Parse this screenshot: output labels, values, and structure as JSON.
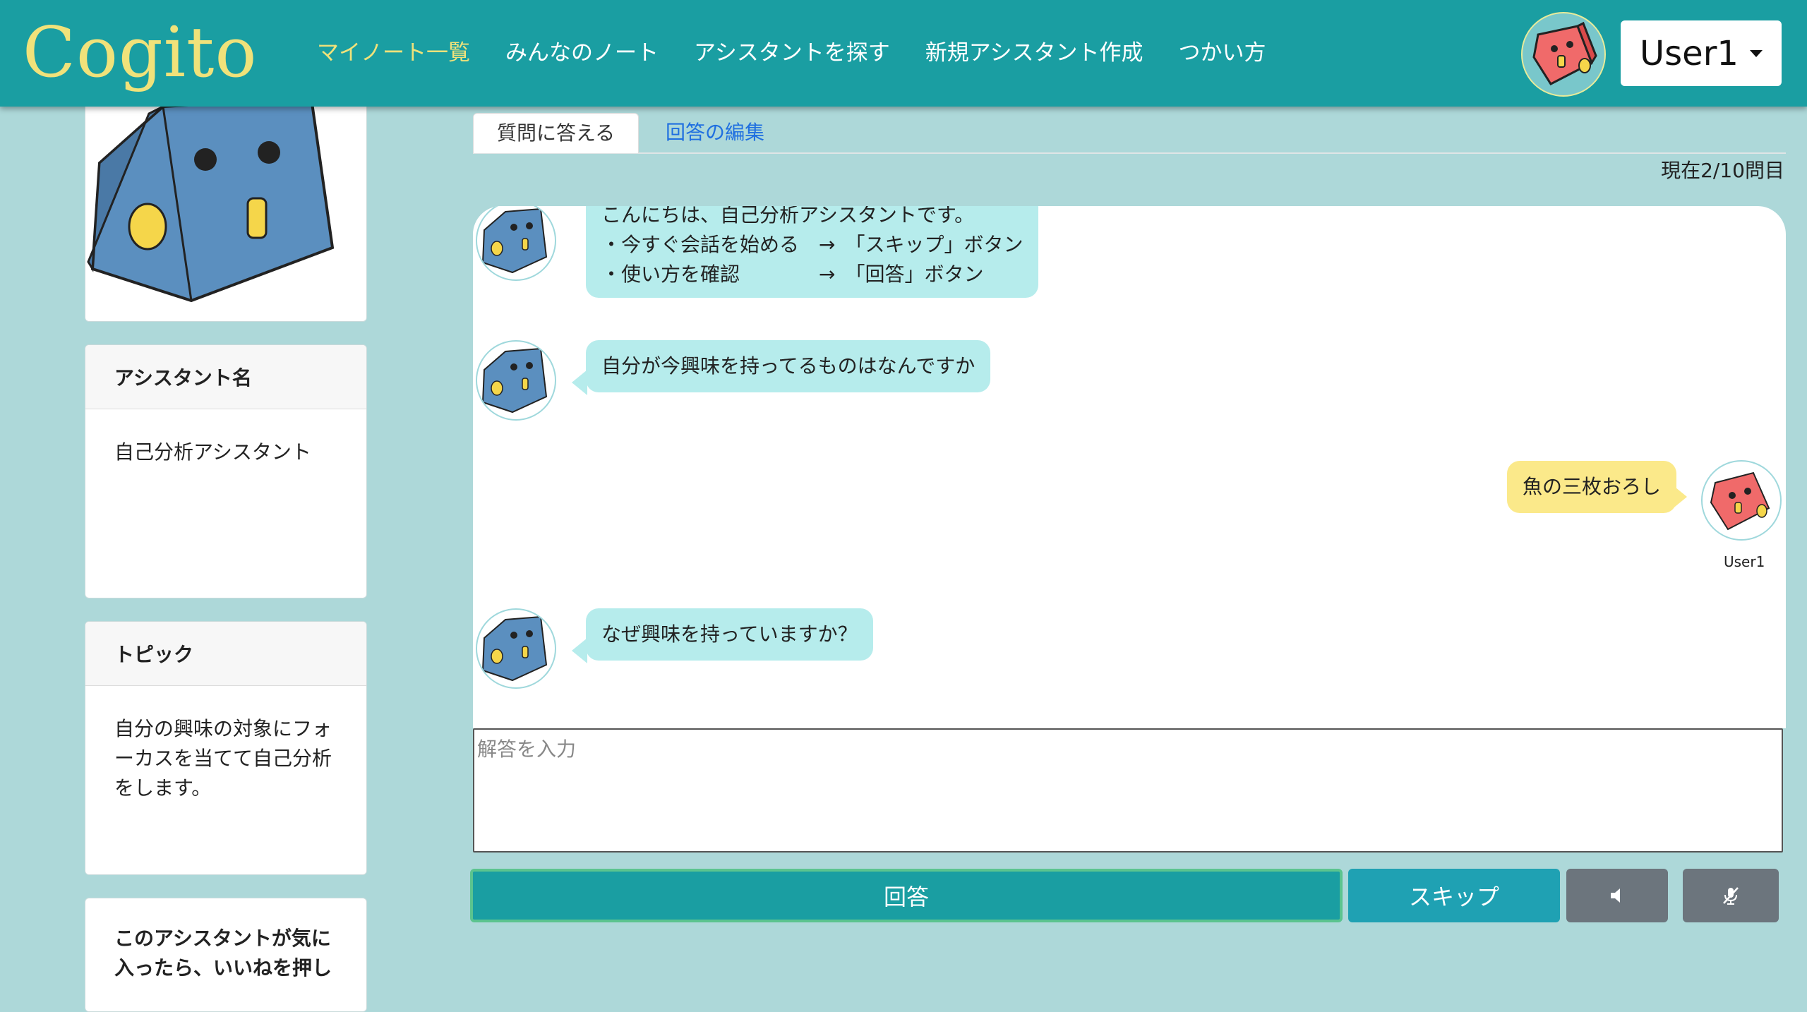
{
  "header": {
    "brand": "Cogito",
    "nav": [
      {
        "label": "マイノート一覧",
        "active": true
      },
      {
        "label": "みんなのノート"
      },
      {
        "label": "アシスタントを探す"
      },
      {
        "label": "新規アシスタント作成"
      },
      {
        "label": "つかい方"
      }
    ],
    "user_name": "User1"
  },
  "sidebar": {
    "assistant_name": {
      "title": "アシスタント名",
      "value": "自己分析アシスタント"
    },
    "topic": {
      "title": "トピック",
      "value": "自分の興味の対象にフォーカスを当てて自己分析をします。"
    },
    "like": {
      "title": "このアシスタントが気に入ったら、いいねを押し"
    }
  },
  "tabs": {
    "answer": "質問に答える",
    "edit": "回答の編集"
  },
  "progress": "現在2/10問目",
  "chat": {
    "messages": [
      {
        "from": "bot",
        "text": "こんにちは、自己分析アシスタントです。\n・今すぐ会話を始める　→　「スキップ」ボタン\n・使い方を確認　　　　→　「回答」ボタン"
      },
      {
        "from": "bot",
        "text": "自分が今興味を持ってるものはなんですか"
      },
      {
        "from": "user",
        "text": "魚の三枚おろし",
        "caption": "User1"
      },
      {
        "from": "bot",
        "text": "なぜ興味を持っていますか？"
      }
    ]
  },
  "input": {
    "placeholder": "解答を入力"
  },
  "buttons": {
    "answer": "回答",
    "skip": "スキップ",
    "sound_icon": "speaker-icon",
    "mic_icon": "mic-off-icon"
  },
  "colors": {
    "header": "#1a9ea2",
    "brand": "#f0e27a",
    "bot_bubble": "#b6ecec",
    "user_bubble": "#fbe98a",
    "background": "#add8d9"
  }
}
